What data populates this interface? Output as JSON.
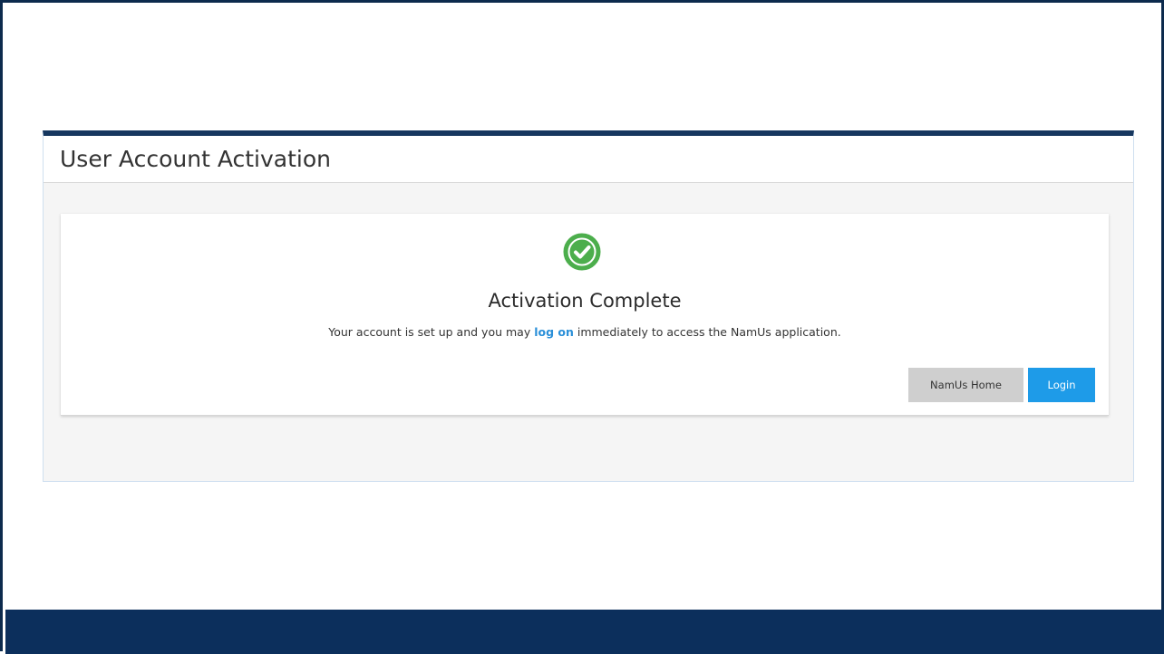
{
  "panel": {
    "title": "User Account Activation"
  },
  "card": {
    "icon": "check-circle-icon",
    "icon_color": "#4cae4c",
    "heading": "Activation Complete",
    "message_before": "Your account is set up and you may ",
    "message_link": "log on",
    "message_after": " immediately to access the NamUs application."
  },
  "buttons": {
    "home_label": "NamUs Home",
    "login_label": "Login"
  },
  "colors": {
    "header_bar": "#16375f",
    "footer_bar": "#0c2f5c",
    "link": "#2a8fd8",
    "login_button": "#1e9be8",
    "home_button": "#cfcfcf"
  }
}
